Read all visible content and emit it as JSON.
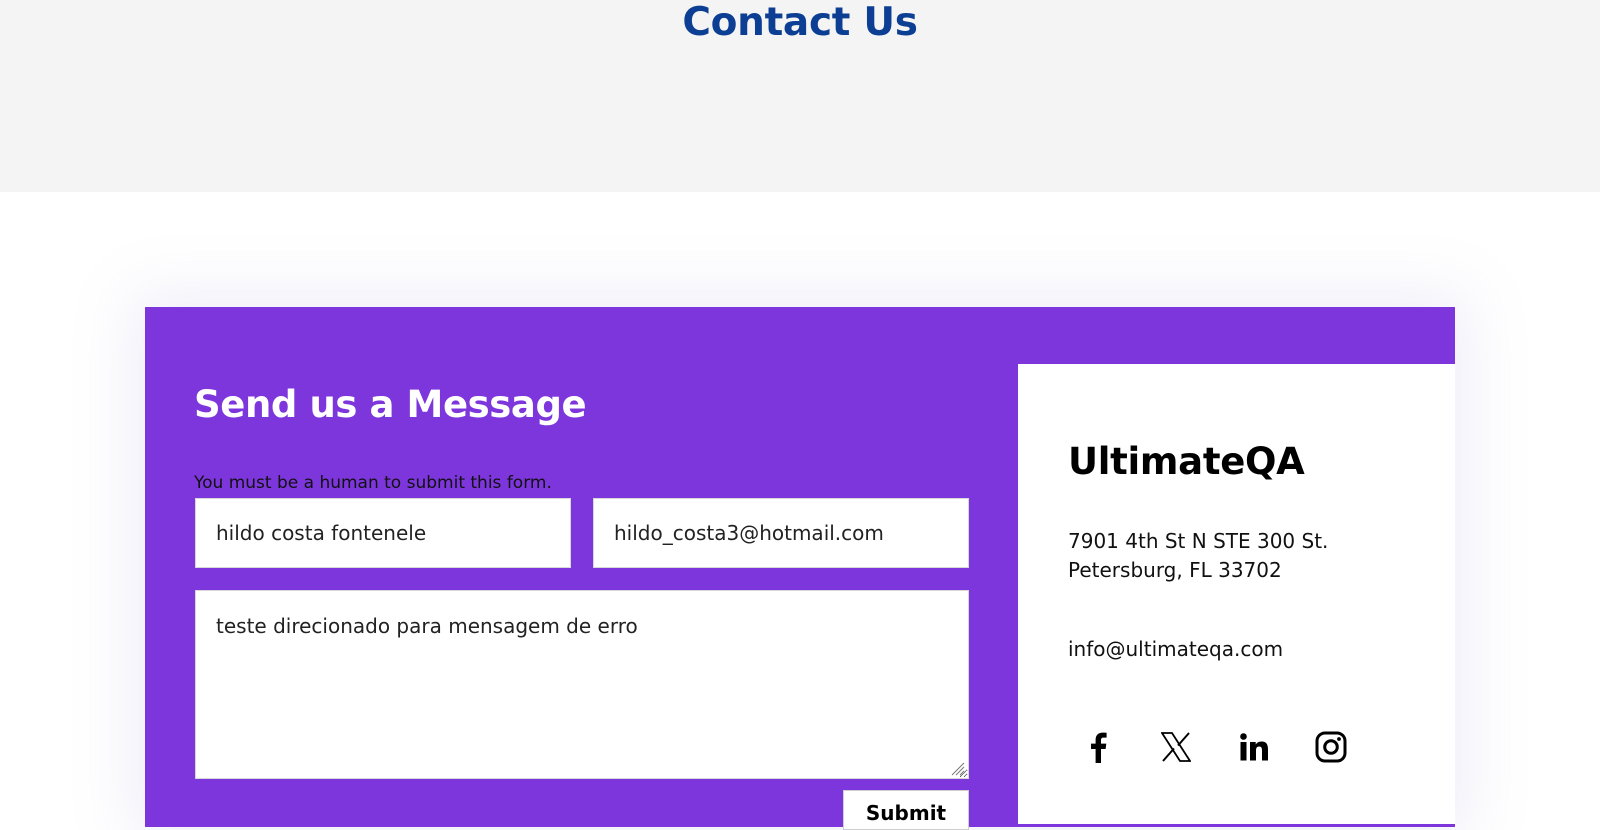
{
  "page": {
    "title": "Contact Us"
  },
  "form": {
    "title": "Send us a Message",
    "human_note": "You must be a human to submit this form.",
    "name_value": "hildo costa fontenele",
    "email_value": "hildo_costa3@hotmail.com",
    "message_value": "teste direcionado para mensagem de erro",
    "submit_label": "Submit"
  },
  "contact_info": {
    "company": "UltimateQA",
    "address_line1": "7901 4th St N STE 300 St.",
    "address_line2": "Petersburg, FL 33702",
    "email": "info@ultimateqa.com"
  },
  "social": [
    {
      "icon": "facebook-icon"
    },
    {
      "icon": "x-twitter-icon"
    },
    {
      "icon": "linkedin-icon"
    },
    {
      "icon": "instagram-icon"
    }
  ],
  "colors": {
    "hero_background": "#f4f4f5",
    "title_blue": "#0c3e93",
    "form_purple": "#7d35dc",
    "panel_white": "#ffffff"
  }
}
